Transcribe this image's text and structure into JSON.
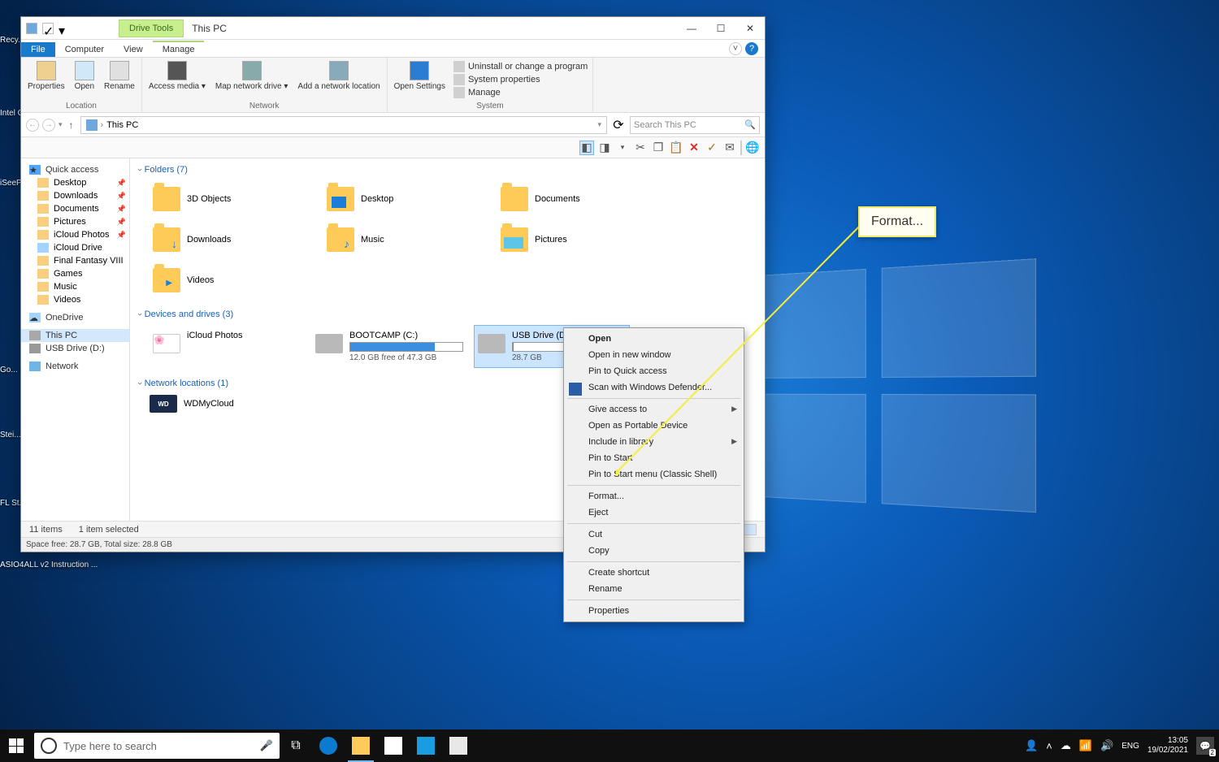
{
  "window": {
    "title": "This PC",
    "drive_tools": "Drive Tools",
    "tabs": {
      "file": "File",
      "computer": "Computer",
      "view": "View",
      "manage": "Manage"
    }
  },
  "ribbon": {
    "location": {
      "properties": "Properties",
      "open": "Open",
      "rename": "Rename",
      "label": "Location"
    },
    "network": {
      "access": "Access media ▾",
      "map": "Map network drive ▾",
      "add": "Add a network location",
      "label": "Network"
    },
    "system": {
      "settings": "Open Settings",
      "uninstall": "Uninstall or change a program",
      "sysprops": "System properties",
      "manage": "Manage",
      "label": "System"
    }
  },
  "address": {
    "path": "This PC",
    "search_placeholder": "Search This PC"
  },
  "nav": {
    "quick": "Quick access",
    "items_q": [
      "Desktop",
      "Downloads",
      "Documents",
      "Pictures",
      "iCloud Photos",
      "iCloud Drive",
      "Final Fantasy VIII",
      "Games",
      "Music",
      "Videos"
    ],
    "onedrive": "OneDrive",
    "thispc": "This PC",
    "usb": "USB Drive (D:)",
    "network": "Network"
  },
  "groups": {
    "folders": {
      "head": "Folders (7)",
      "items": [
        "3D Objects",
        "Desktop",
        "Documents",
        "Downloads",
        "Music",
        "Pictures",
        "Videos"
      ]
    },
    "drives": {
      "head": "Devices and drives (3)",
      "icloud": "iCloud Photos",
      "bootcamp": {
        "name": "BOOTCAMP (C:)",
        "sub": "12.0 GB free of 47.3 GB",
        "pct": 75
      },
      "usb": {
        "name": "USB Drive (D:)",
        "sub": "28.7 GB",
        "pct": 1
      }
    },
    "net": {
      "head": "Network locations (1)",
      "wd": "WDMyCloud"
    }
  },
  "status": {
    "items": "11 items",
    "selected": "1 item selected",
    "space": "Space free: 28.7 GB, Total size: 28.8 GB"
  },
  "context": {
    "open": "Open",
    "open_new": "Open in new window",
    "pin_qa": "Pin to Quick access",
    "defender": "Scan with Windows Defender...",
    "give_access": "Give access to",
    "portable": "Open as Portable Device",
    "include_lib": "Include in library",
    "pin_start": "Pin to Start",
    "pin_classic": "Pin to Start menu (Classic Shell)",
    "format": "Format...",
    "eject": "Eject",
    "cut": "Cut",
    "copy": "Copy",
    "shortcut": "Create shortcut",
    "rename": "Rename",
    "properties": "Properties"
  },
  "callout": {
    "text": "Format..."
  },
  "desktop": {
    "labels": [
      "Recy...",
      "Intel Grap...",
      "iSeePa...",
      "Go... Ch...",
      "Stei... Do...",
      "FL St...",
      "ASIO4ALL v2 Instruction ..."
    ]
  },
  "taskbar": {
    "search_placeholder": "Type here to search",
    "time": "13:05",
    "date": "19/02/2021",
    "notif_count": "2"
  }
}
